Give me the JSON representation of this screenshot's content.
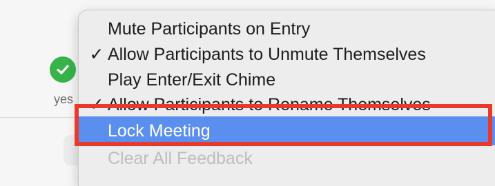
{
  "background": {
    "status_label": "yes",
    "status_icon": "checkmark-circle-icon",
    "status_color": "#37b34a"
  },
  "menu": {
    "items": [
      {
        "label": "Mute Participants on Entry",
        "checked": false,
        "state": "normal"
      },
      {
        "label": "Allow Participants to Unmute Themselves",
        "checked": true,
        "state": "normal"
      },
      {
        "label": "Play Enter/Exit Chime",
        "checked": false,
        "state": "normal"
      },
      {
        "label": "Allow Participants to Rename Themselves",
        "checked": true,
        "state": "normal"
      },
      {
        "label": "Lock Meeting",
        "checked": false,
        "state": "highlighted"
      },
      {
        "label": "Clear All Feedback",
        "checked": false,
        "state": "disabled"
      }
    ],
    "check_glyph": "✓",
    "highlight_color": "#5a8ff0"
  },
  "annotation": {
    "box_color": "#e8392a"
  }
}
